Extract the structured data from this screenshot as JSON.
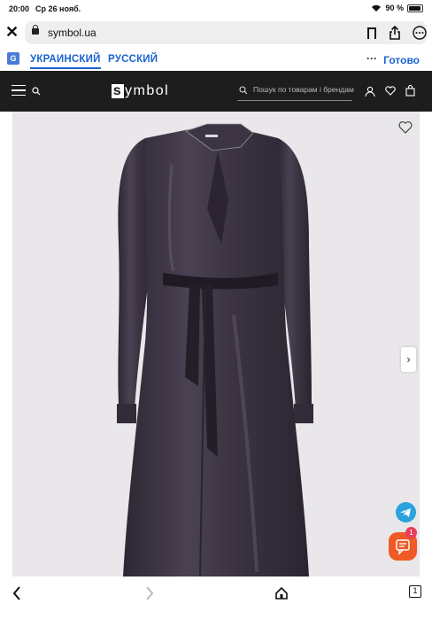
{
  "status": {
    "time": "20:00",
    "date": "Ср 26 нояб.",
    "battery": "90 %"
  },
  "browser": {
    "url": "symbol.ua"
  },
  "translate": {
    "logo": "G",
    "lang_ua": "УКРАИНСКИЙ",
    "lang_ru": "РУССКИЙ",
    "more": "···",
    "done": "Готово"
  },
  "header": {
    "logo_letter": "s",
    "logo_rest": "ymbol",
    "search_placeholder": "Пошук по товарам і брендам"
  },
  "product": {
    "dress_color": "#3e3544"
  },
  "chat": {
    "badge": "1"
  },
  "bottom": {
    "tabs_count": "1"
  }
}
